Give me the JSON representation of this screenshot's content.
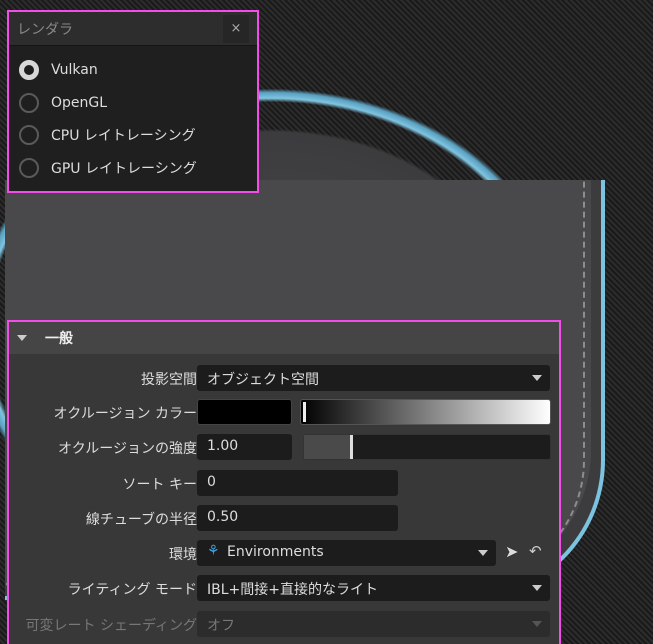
{
  "renderer": {
    "title": "レンダラ",
    "close": "×",
    "options": [
      {
        "label": "Vulkan",
        "selected": true
      },
      {
        "label": "OpenGL",
        "selected": false
      },
      {
        "label": "CPU レイトレーシング",
        "selected": false
      },
      {
        "label": "GPU レイトレーシング",
        "selected": false
      }
    ]
  },
  "general": {
    "title": "一般",
    "projection_space": {
      "label": "投影空間",
      "value": "オブジェクト空間"
    },
    "occlusion_color": {
      "label": "オクルージョン カラー",
      "color": "#000000"
    },
    "occlusion_strength": {
      "label": "オクルージョンの強度",
      "value": "1.00",
      "slider_fraction": 0.2
    },
    "sort_key": {
      "label": "ソート キー",
      "value": "0"
    },
    "line_tube_radius": {
      "label": "線チューブの半径",
      "value": "0.50"
    },
    "environment": {
      "label": "環境",
      "value": "Environments"
    },
    "lighting_mode": {
      "label": "ライティング モード",
      "value": "IBL+間接+直接的なライト"
    },
    "variable_rate_shading": {
      "label": "可変レート シェーディング",
      "value": "オフ",
      "disabled": true
    }
  },
  "colors": {
    "highlight": "#f24de8",
    "accent": "#7fc4e0"
  }
}
